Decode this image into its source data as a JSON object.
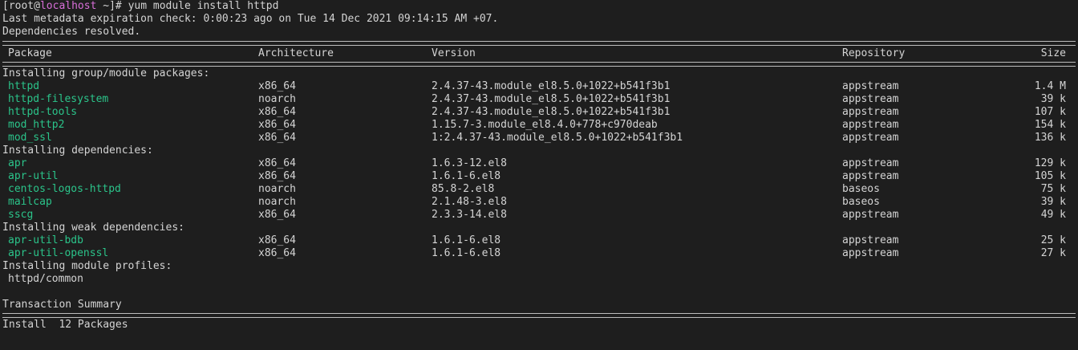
{
  "prompt": {
    "open": "[root@",
    "host": "localhost",
    "close": " ~]# ",
    "command": "yum module install httpd"
  },
  "metadata_line": "Last metadata expiration check: 0:00:23 ago on Tue 14 Dec 2021 09:14:15 AM +07.",
  "deps_resolved": "Dependencies resolved.",
  "headers": {
    "package": "Package",
    "architecture": "Architecture",
    "version": "Version",
    "repository": "Repository",
    "size": "Size"
  },
  "groups": [
    {
      "title": "Installing group/module packages:",
      "rows": [
        {
          "name": "httpd",
          "arch": "x86_64",
          "version": "2.4.37-43.module_el8.5.0+1022+b541f3b1",
          "repo": "appstream",
          "size": "1.4 M"
        },
        {
          "name": "httpd-filesystem",
          "arch": "noarch",
          "version": "2.4.37-43.module_el8.5.0+1022+b541f3b1",
          "repo": "appstream",
          "size": "39 k"
        },
        {
          "name": "httpd-tools",
          "arch": "x86_64",
          "version": "2.4.37-43.module_el8.5.0+1022+b541f3b1",
          "repo": "appstream",
          "size": "107 k"
        },
        {
          "name": "mod_http2",
          "arch": "x86_64",
          "version": "1.15.7-3.module_el8.4.0+778+c970deab",
          "repo": "appstream",
          "size": "154 k"
        },
        {
          "name": "mod_ssl",
          "arch": "x86_64",
          "version": "1:2.4.37-43.module_el8.5.0+1022+b541f3b1",
          "repo": "appstream",
          "size": "136 k"
        }
      ]
    },
    {
      "title": "Installing dependencies:",
      "rows": [
        {
          "name": "apr",
          "arch": "x86_64",
          "version": "1.6.3-12.el8",
          "repo": "appstream",
          "size": "129 k"
        },
        {
          "name": "apr-util",
          "arch": "x86_64",
          "version": "1.6.1-6.el8",
          "repo": "appstream",
          "size": "105 k"
        },
        {
          "name": "centos-logos-httpd",
          "arch": "noarch",
          "version": "85.8-2.el8",
          "repo": "baseos",
          "size": "75 k"
        },
        {
          "name": "mailcap",
          "arch": "noarch",
          "version": "2.1.48-3.el8",
          "repo": "baseos",
          "size": "39 k"
        },
        {
          "name": "sscg",
          "arch": "x86_64",
          "version": "2.3.3-14.el8",
          "repo": "appstream",
          "size": "49 k"
        }
      ]
    },
    {
      "title": "Installing weak dependencies:",
      "rows": [
        {
          "name": "apr-util-bdb",
          "arch": "x86_64",
          "version": "1.6.1-6.el8",
          "repo": "appstream",
          "size": "25 k"
        },
        {
          "name": "apr-util-openssl",
          "arch": "x86_64",
          "version": "1.6.1-6.el8",
          "repo": "appstream",
          "size": "27 k"
        }
      ]
    }
  ],
  "profiles": {
    "title": "Installing module profiles:",
    "items": [
      "httpd/common"
    ]
  },
  "transaction_summary": "Transaction Summary",
  "install_line": "Install  12 Packages",
  "colors": {
    "background": "#1e1e1e",
    "text": "#d4d4d4",
    "package_name": "#2bc48a",
    "hostname": "#d96fd9"
  }
}
